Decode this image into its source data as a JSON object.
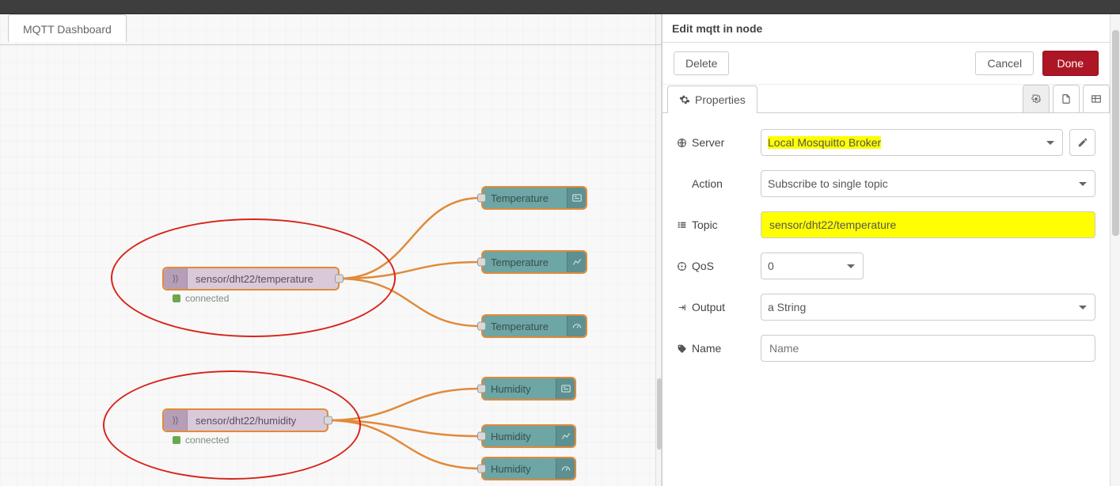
{
  "tab_title": "MQTT Dashboard",
  "flow": {
    "mqtt1": {
      "label": "sensor/dht22/temperature",
      "status": "connected"
    },
    "mqtt2": {
      "label": "sensor/dht22/humidity",
      "status": "connected"
    },
    "t1": "Temperature",
    "t2": "Temperature",
    "t3": "Temperature",
    "h1": "Humidity",
    "h2": "Humidity",
    "h3": "Humidity"
  },
  "edit": {
    "title": "Edit mqtt in node",
    "delete": "Delete",
    "cancel": "Cancel",
    "done": "Done",
    "tab_properties": "Properties",
    "labels": {
      "server": "Server",
      "action": "Action",
      "topic": "Topic",
      "qos": "QoS",
      "output": "Output",
      "name": "Name"
    },
    "values": {
      "server": "Local Mosquitto Broker",
      "action": "Subscribe to single topic",
      "topic": "sensor/dht22/temperature",
      "qos": "0",
      "output": "a String",
      "name_placeholder": "Name"
    }
  }
}
